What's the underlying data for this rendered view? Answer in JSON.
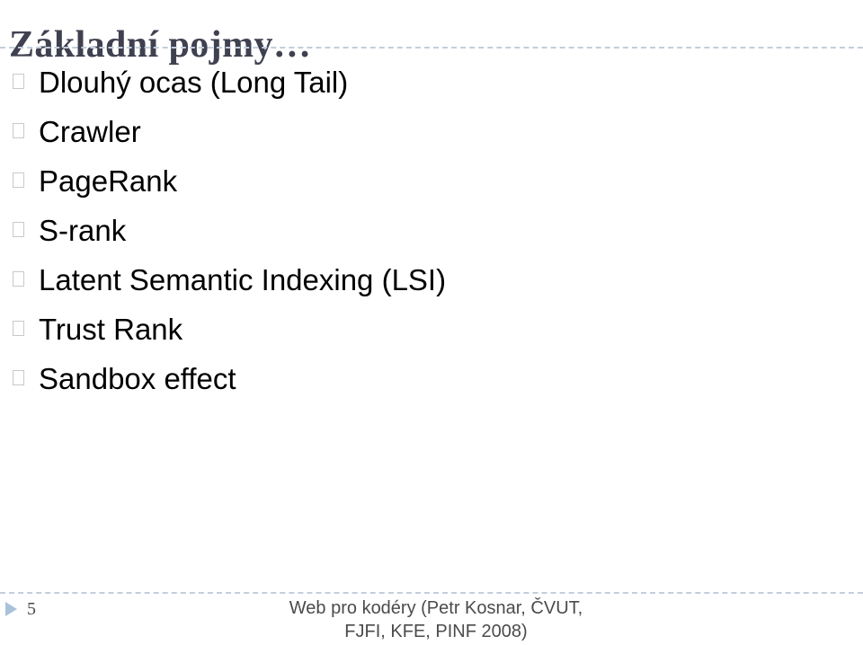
{
  "slide": {
    "title": "Základní pojmy…",
    "bullets": [
      {
        "marker": "missing-glyph-box",
        "text": "Dlouhý ocas (Long Tail)"
      },
      {
        "marker": "missing-glyph-box",
        "text": "Crawler"
      },
      {
        "marker": "missing-glyph-box",
        "text": "PageRank"
      },
      {
        "marker": "missing-glyph-box",
        "text": "S-rank"
      },
      {
        "marker": "missing-glyph-box",
        "text": "Latent Semantic Indexing (LSI)"
      },
      {
        "marker": "missing-glyph-box",
        "text": "Trust Rank"
      },
      {
        "marker": "missing-glyph-box",
        "text": "Sandbox effect"
      }
    ],
    "footer": {
      "nav_icon": "triangle-right-icon",
      "page_number": "5",
      "credit_line_1": "Web pro kodéry (Petr Kosnar, ČVUT,",
      "credit_line_2": "FJFI, KFE, PINF 2008)"
    },
    "colors": {
      "title": "#3f4150",
      "body_text": "#000000",
      "rule": "#c3cddc",
      "marker_border": "#c9c9c9",
      "triangle": "#a9c2da",
      "footer_text": "#4b4b4b",
      "background": "#ffffff"
    }
  }
}
